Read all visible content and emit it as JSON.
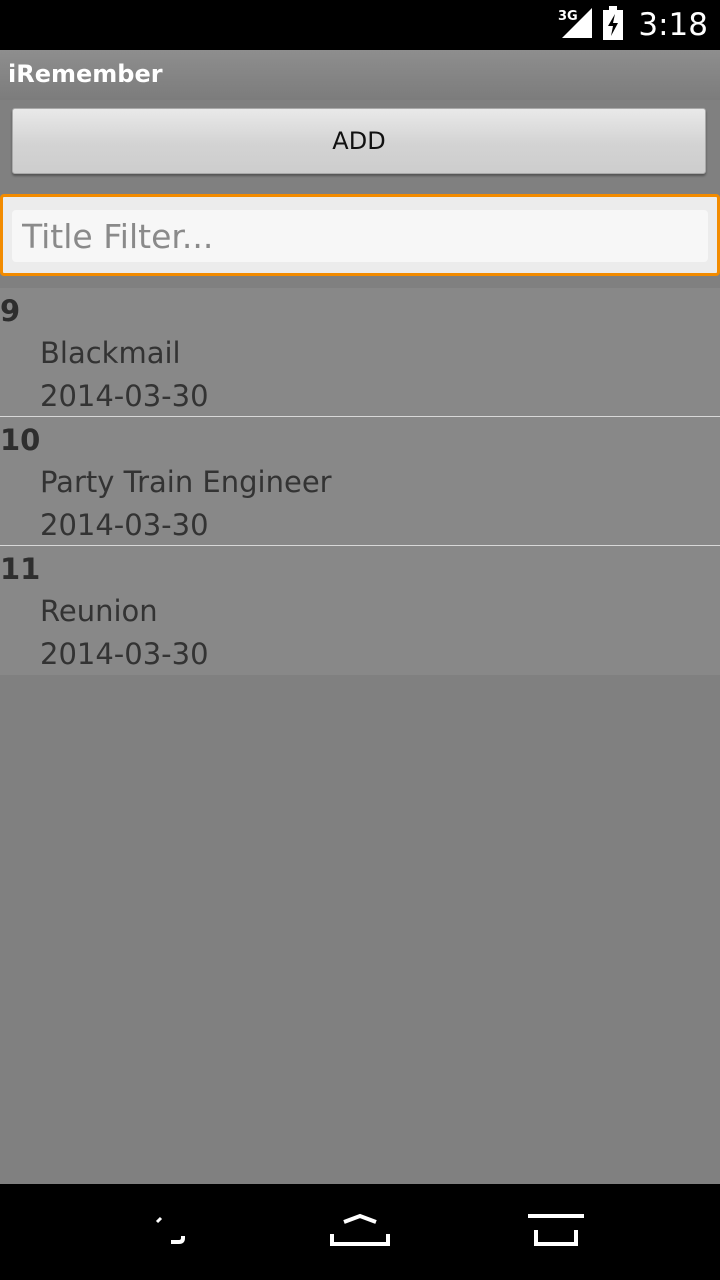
{
  "status_bar": {
    "network": "3G",
    "time": "3:18"
  },
  "app": {
    "title": "iRemember"
  },
  "toolbar": {
    "add_label": "ADD"
  },
  "filter": {
    "placeholder": "Title Filter...",
    "value": ""
  },
  "items": [
    {
      "id": "9",
      "title": "Blackmail",
      "date": "2014-03-30"
    },
    {
      "id": "10",
      "title": "Party Train Engineer",
      "date": "2014-03-30"
    },
    {
      "id": "11",
      "title": "Reunion",
      "date": "2014-03-30"
    }
  ],
  "colors": {
    "background": "#808080",
    "list_background": "#888888",
    "focus_accent": "#f28b00",
    "bars": "#000000"
  },
  "icons": {
    "status": [
      "signal-3g-icon",
      "battery-charging-icon"
    ],
    "nav": [
      "back-icon",
      "home-icon",
      "recent-apps-icon"
    ]
  }
}
